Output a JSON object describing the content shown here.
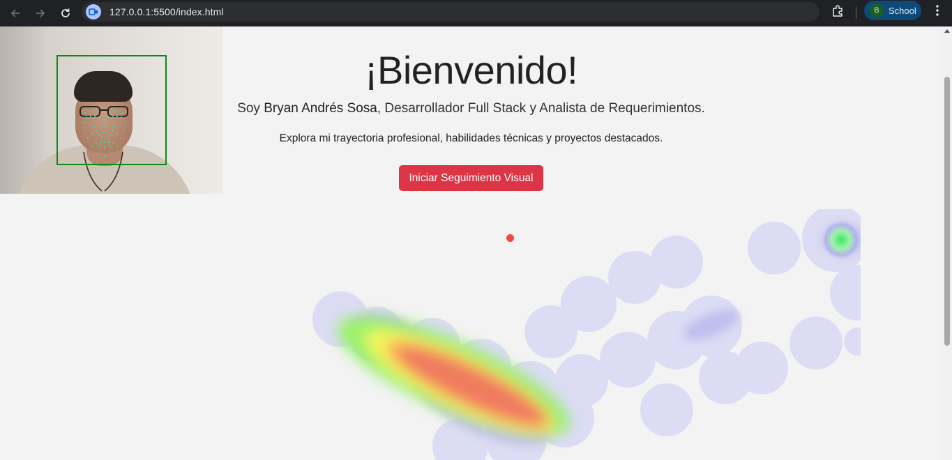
{
  "browser": {
    "url": "127.0.0.1:5500/index.html",
    "profile_initial": "B",
    "profile_name": "School"
  },
  "hero": {
    "title": "¡Bienvenido!",
    "intro_prefix": "Soy ",
    "intro_name": "Bryan Andrés Sosa",
    "intro_suffix": ", Desarrollador Full Stack y Analista de Requerimientos.",
    "explore": "Explora mi trayectoria profesional, habilidades técnicas y proyectos destacados.",
    "start_button": "Iniciar Seguimiento Visual"
  },
  "colors": {
    "button": "#dc3545",
    "face_box": "#0a8c14",
    "gaze_dot": "#f04848",
    "profile_chip": "#0b4a7a"
  }
}
